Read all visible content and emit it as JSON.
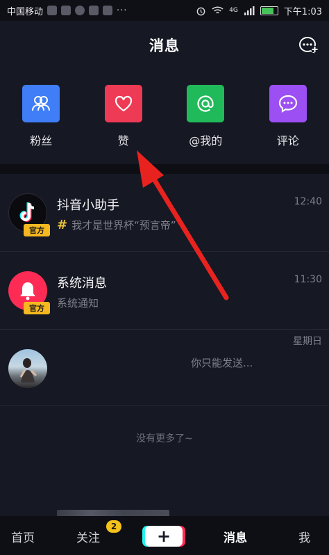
{
  "status_bar": {
    "carrier": "中国移动",
    "signal_label": "4G",
    "time": "下午1:03",
    "more": "···"
  },
  "header": {
    "title": "消息"
  },
  "quick_actions": [
    {
      "label": "粉丝",
      "icon": "fans-icon",
      "color": "#3f7ef7"
    },
    {
      "label": "赞",
      "icon": "heart-icon",
      "color": "#ee3a55"
    },
    {
      "label": "@我的",
      "icon": "at-icon",
      "color": "#21ba5a"
    },
    {
      "label": "评论",
      "icon": "comment-icon",
      "color": "#9c4ff2"
    }
  ],
  "messages": [
    {
      "title": "抖音小助手",
      "badge": "官方",
      "subtitle": "我才是世界杯“预言帝”",
      "time": "12:40"
    },
    {
      "title": "系统消息",
      "badge": "官方",
      "subtitle": "系统通知",
      "time": "11:30"
    },
    {
      "title": "",
      "subtitle": "你只能发送...",
      "time": "星期日"
    }
  ],
  "footer_note": "没有更多了~",
  "tabbar": {
    "home": "首页",
    "follow": "关注",
    "follow_badge": "2",
    "add": "+",
    "messages": "消息",
    "me": "我"
  }
}
